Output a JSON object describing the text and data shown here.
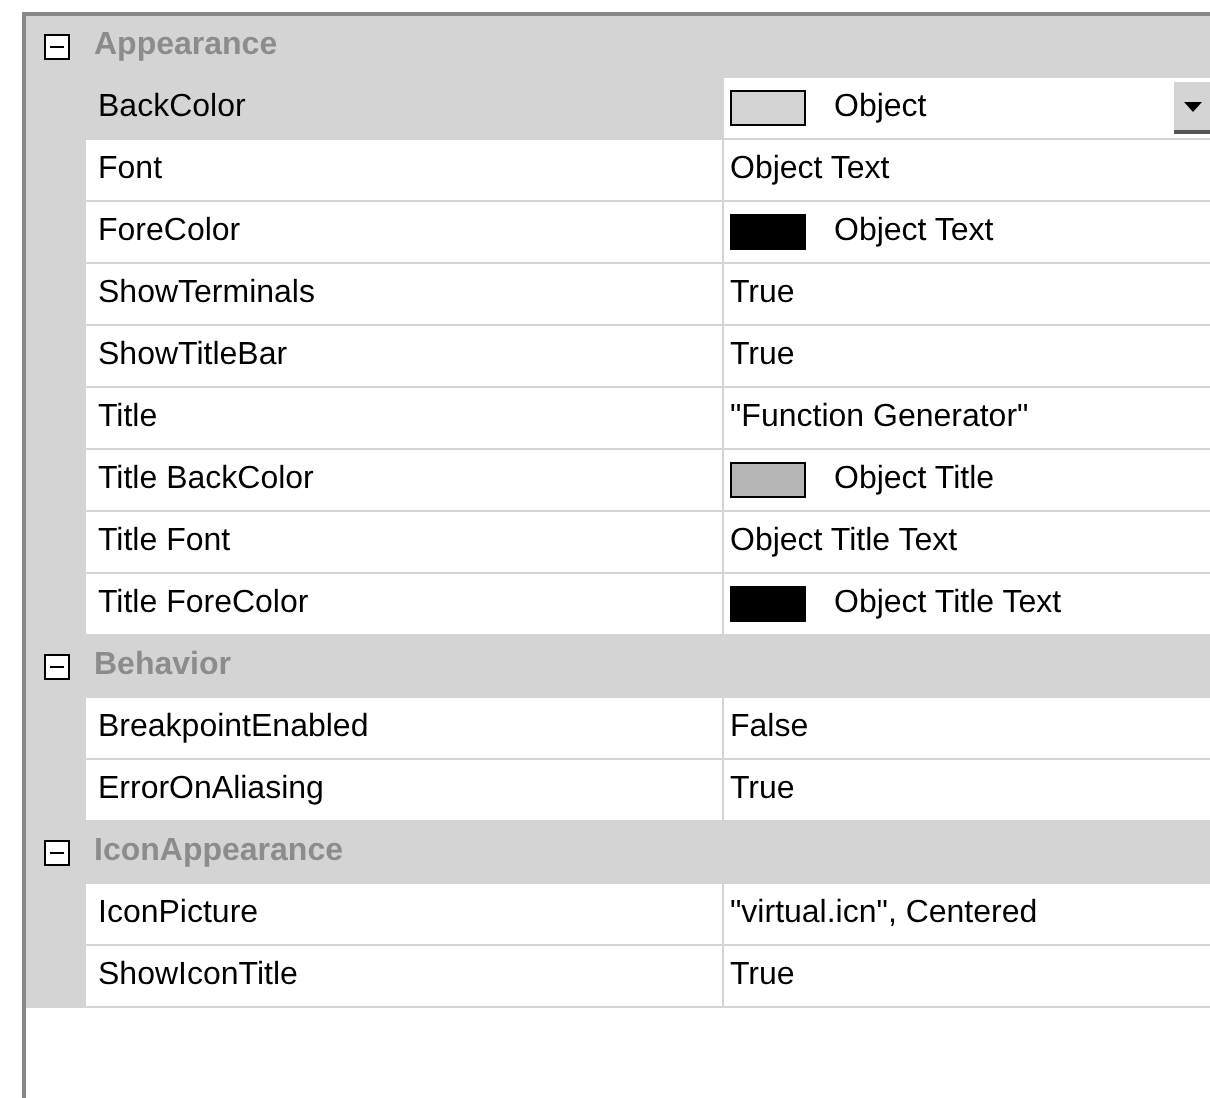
{
  "categories": [
    {
      "name": "Appearance",
      "expanded": true,
      "properties": [
        {
          "name": "BackColor",
          "value": "Object",
          "selected": true,
          "color": "#d4d4d4"
        },
        {
          "name": "Font",
          "value": "Object Text",
          "selected": false
        },
        {
          "name": "ForeColor",
          "value": "Object Text",
          "selected": false,
          "color": "#000000"
        },
        {
          "name": "ShowTerminals",
          "value": "True",
          "selected": false
        },
        {
          "name": "ShowTitleBar",
          "value": "True",
          "selected": false
        },
        {
          "name": "Title",
          "value": "\"Function Generator\"",
          "selected": false
        },
        {
          "name": "Title BackColor",
          "value": "Object Title",
          "selected": false,
          "color": "#b4b4b4"
        },
        {
          "name": "Title Font",
          "value": "Object Title Text",
          "selected": false
        },
        {
          "name": "Title ForeColor",
          "value": "Object Title Text",
          "selected": false,
          "color": "#000000"
        }
      ]
    },
    {
      "name": "Behavior",
      "expanded": true,
      "properties": [
        {
          "name": "BreakpointEnabled",
          "value": "False",
          "selected": false
        },
        {
          "name": "ErrorOnAliasing",
          "value": "True",
          "selected": false
        }
      ]
    },
    {
      "name": "IconAppearance",
      "expanded": true,
      "properties": [
        {
          "name": "IconPicture",
          "value": "\"virtual.icn\", Centered",
          "selected": false
        },
        {
          "name": "ShowIconTitle",
          "value": "True",
          "selected": false
        }
      ]
    }
  ]
}
